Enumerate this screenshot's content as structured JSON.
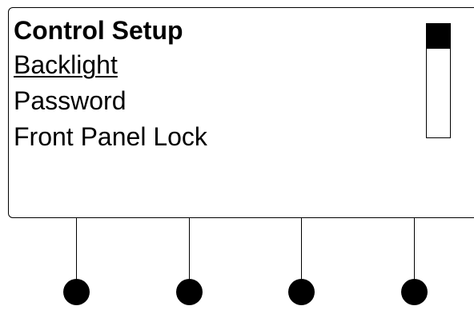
{
  "screen": {
    "title": "Control Setup",
    "menu_items": [
      {
        "label": "Backlight",
        "selected": true
      },
      {
        "label": "Password",
        "selected": false
      },
      {
        "label": "Front Panel Lock",
        "selected": false
      }
    ],
    "scroll": {
      "position_fraction": 0.0,
      "thumb_fraction": 0.22
    }
  },
  "softkeys": [
    {
      "name": "softkey-1"
    },
    {
      "name": "softkey-2"
    },
    {
      "name": "softkey-3"
    },
    {
      "name": "softkey-4"
    }
  ],
  "colors": {
    "foreground": "#000000",
    "background": "#ffffff"
  }
}
